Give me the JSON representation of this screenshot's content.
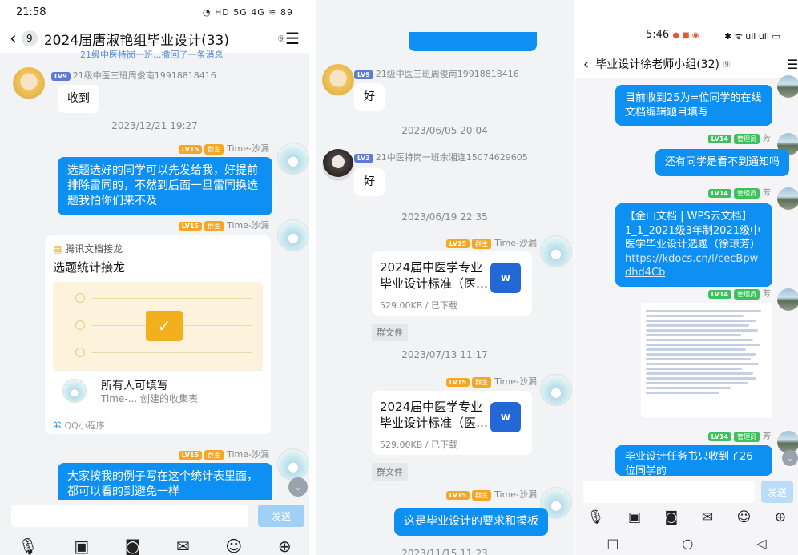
{
  "p1": {
    "status_time": "21:58",
    "status_right": "◔ HD 5G 4G ≋ 89",
    "badge": "9",
    "title": "2024届唐淑艳组毕业设计(33)",
    "top_partial": "21级中医特岗一班...撤回了一条消息",
    "msg1_name": "21级中医三班周俊南19918818416",
    "msg1_lv": "LV9",
    "msg1_text": "收到",
    "time1": "2023/12/21 19:27",
    "owner_lv": "LV15",
    "owner_role": "群主",
    "owner_name": "Time-沙漏",
    "msg2_text": "选题选好的同学可以先发给我，好提前排除雷同的，不然到后面一旦雷同换选题我怕你们来不及",
    "card_source": "腾讯文档接龙",
    "card_title": "选题统计接龙",
    "card_user_title": "所有人可填写",
    "card_user_sub": "Time-... 创建的收集表",
    "card_footer": "QQ小程序",
    "msg4_text": "大家按我的例子写在这个统计表里面，都可以看的到避免一样",
    "send": "发送"
  },
  "p2": {
    "msg1_name": "21级中医三班周俊南19918818416",
    "msg1_lv": "LV9",
    "msg1_text": "好",
    "time1": "2023/06/05 20:04",
    "msg2_name": "21中医特岗一班余湘连15074629605",
    "msg2_lv": "LV3",
    "msg2_text": "好",
    "time2": "2023/06/19 22:35",
    "owner_lv": "LV15",
    "owner_role": "群主",
    "owner_name": "Time-沙漏",
    "file1_name": "2024届中医学专业毕业设计标准（医…",
    "file1_size": "529.00KB / 已下载",
    "tag": "群文件",
    "time3": "2023/07/13 11:17",
    "file2_name": "2024届中医学专业毕业设计标准（医…",
    "file2_size": "529.00KB / 已下载",
    "msg_last": "这是毕业设计的要求和摸板",
    "time4": "2023/11/15 11:23"
  },
  "p3": {
    "status_time": "5:46",
    "status_right": "✱ ᯤ ull ull ▭",
    "title": "毕业设计徐老师小组(32)",
    "msg0_text": "目前收到25为=位同学的在线文档编辑题目填写",
    "admin_lv": "LV14",
    "admin_role": "管理员",
    "admin_name": "芳",
    "msg1_text": "还有同学是看不到通知吗",
    "msg2_line1": "【金山文档 | WPS云文档】",
    "msg2_line2": "1_1_2021级3年制2021级中医学毕业设计选题（徐琼芳）",
    "msg2_link": "https://kdocs.cn/l/cecBpwdhd4Cb",
    "msg4_text": "毕业设计任务书只收到了26位同学的",
    "send": "发送"
  }
}
